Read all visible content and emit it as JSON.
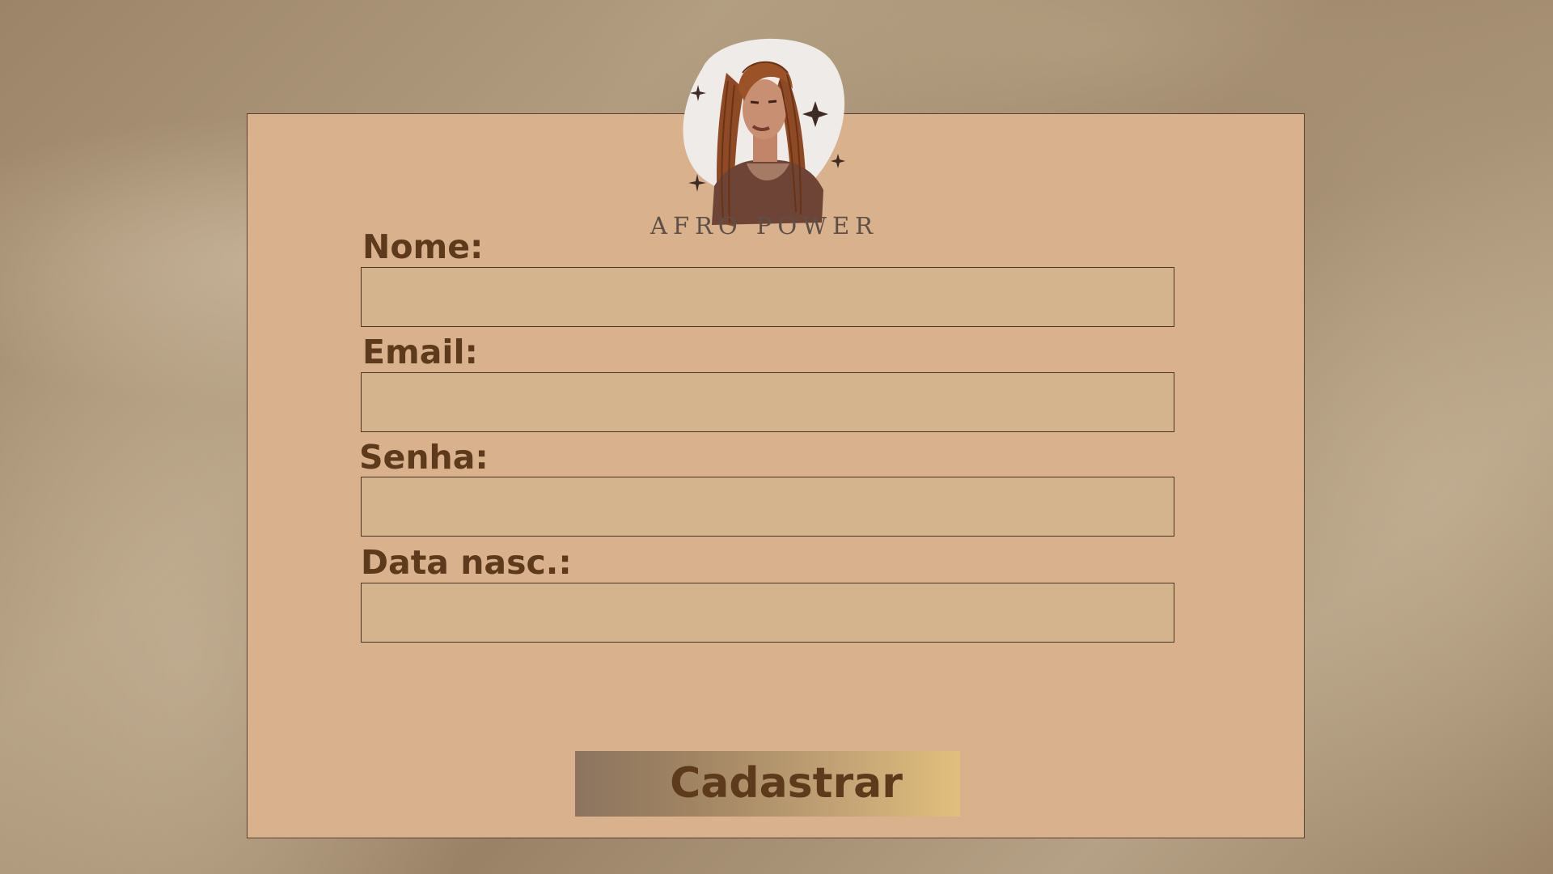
{
  "brand": {
    "name": "AFRO POWER"
  },
  "form": {
    "fields": [
      {
        "label": "Nome:",
        "value": "",
        "placeholder": ""
      },
      {
        "label": "Email:",
        "value": "",
        "placeholder": ""
      },
      {
        "label": "Senha:",
        "value": "",
        "placeholder": ""
      },
      {
        "label": "Data nasc.:",
        "value": "",
        "placeholder": ""
      }
    ],
    "submit_label": "Cadastrar"
  },
  "colors": {
    "card": "#d9b28d",
    "input": "#d3b48c",
    "text": "#5d3a1c",
    "button_gradient_start": "#8c7460",
    "button_gradient_end": "#e1bf7c"
  },
  "icons": {
    "logo": "woman-with-braids-icon",
    "sparkle": "sparkle-icon"
  }
}
